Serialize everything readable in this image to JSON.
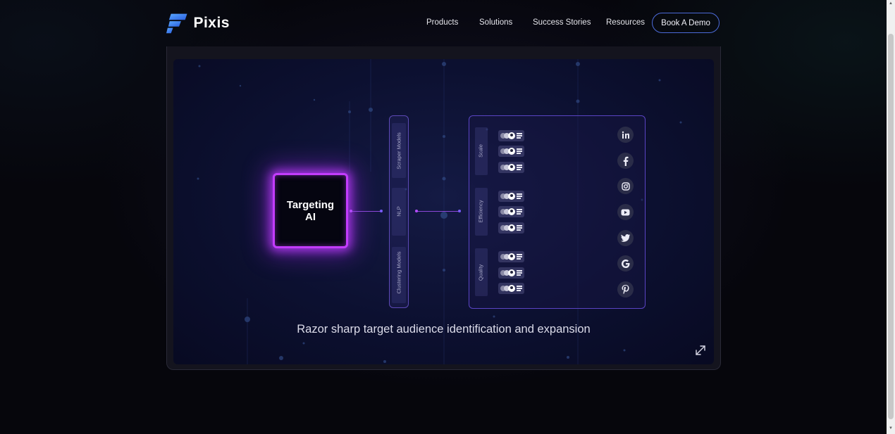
{
  "brand": {
    "name": "Pixis",
    "accent": "#3f78f0"
  },
  "nav": {
    "items": [
      "Products",
      "Solutions",
      "Success Stories",
      "Resources"
    ],
    "cta": "Book A Demo"
  },
  "diagram": {
    "core_label": "Targeting AI",
    "models": [
      "Scraper Models",
      "NLP",
      "Clustering Models"
    ],
    "segments": [
      "Scale",
      "Efficiency",
      "Quality"
    ],
    "channels": [
      "linkedin-icon",
      "facebook-icon",
      "instagram-icon",
      "youtube-icon",
      "twitter-icon",
      "google-icon",
      "pinterest-icon"
    ],
    "colors": {
      "glow": "#c33cff",
      "border": "#5a44c4"
    }
  },
  "caption": "Razor sharp target audience identification and expansion",
  "icons": {
    "expand": "expand-icon"
  }
}
